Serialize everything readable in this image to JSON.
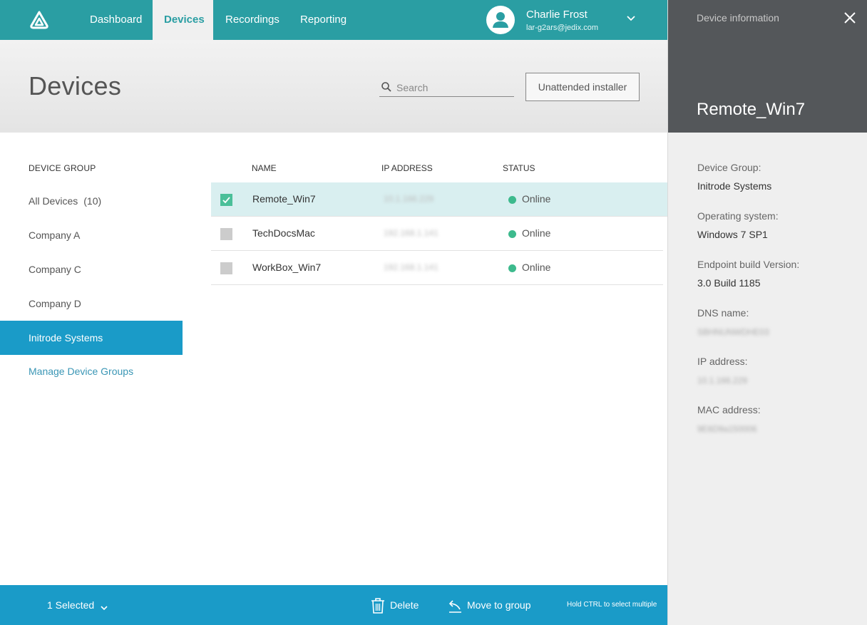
{
  "nav": {
    "tabs": [
      "Dashboard",
      "Devices",
      "Recordings",
      "Reporting"
    ],
    "active": "Devices"
  },
  "user": {
    "name": "Charlie Frost",
    "email": "lar-g2ars@jedix.com"
  },
  "page": {
    "title": "Devices",
    "search_placeholder": "Search",
    "installer_label": "Unattended installer"
  },
  "groups": {
    "title": "DEVICE GROUP",
    "items": [
      {
        "label": "All Devices",
        "count": "(10)"
      },
      {
        "label": "Company A"
      },
      {
        "label": "Company C"
      },
      {
        "label": "Company D"
      },
      {
        "label": "Initrode Systems"
      }
    ],
    "active": "Initrode Systems",
    "manage_label": "Manage Device Groups"
  },
  "table": {
    "columns": [
      "NAME",
      "IP ADDRESS",
      "STATUS"
    ],
    "rows": [
      {
        "name": "Remote_Win7",
        "ip": "10.1.166.229",
        "status": "Online",
        "checked": true
      },
      {
        "name": "TechDocsMac",
        "ip": "192.168.1.141",
        "status": "Online",
        "checked": false
      },
      {
        "name": "WorkBox_Win7",
        "ip": "192.168.1.141",
        "status": "Online",
        "checked": false
      }
    ]
  },
  "actions": {
    "selected_label": "1 Selected",
    "delete_label": "Delete",
    "move_label": "Move to group",
    "hint": "Hold CTRL to select multiple"
  },
  "detail": {
    "panel_title": "Device information",
    "device_name": "Remote_Win7",
    "fields": [
      {
        "label": "Device Group:",
        "value": "Initrode Systems",
        "blurred": false
      },
      {
        "label": "Operating system:",
        "value": "Windows 7 SP1",
        "blurred": false
      },
      {
        "label": "Endpoint build Version:",
        "value": "3.0 Build 1185",
        "blurred": false
      },
      {
        "label": "DNS name:",
        "value": "SBHNUNWDHE03",
        "blurred": true
      },
      {
        "label": "IP address:",
        "value": "10.1.166.229",
        "blurred": true
      },
      {
        "label": "MAC address:",
        "value": "9E6D9a150006",
        "blurred": true
      }
    ]
  },
  "colors": {
    "nav": "#2a9ea3",
    "accent": "#1a9bc8",
    "online": "#3dba8d",
    "panel_head": "#54575a"
  }
}
